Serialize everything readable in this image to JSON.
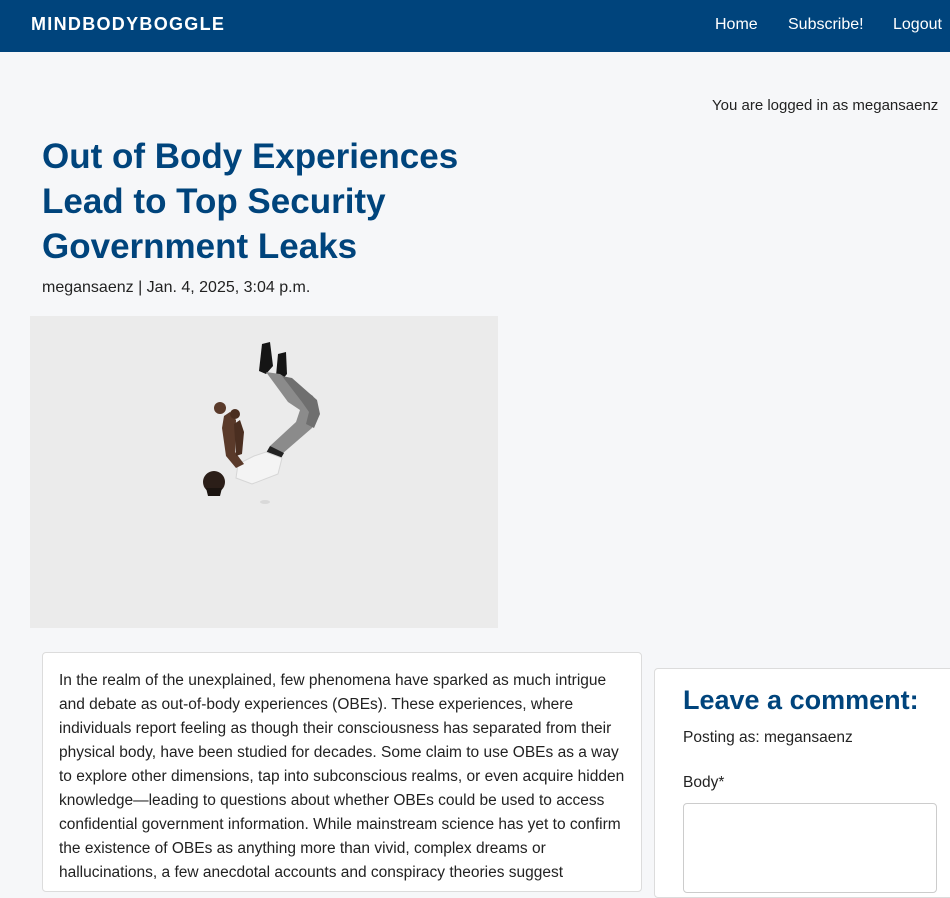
{
  "navbar": {
    "brand": "MINDBODYBOGGLE",
    "links": [
      {
        "label": "Home"
      },
      {
        "label": "Subscribe!"
      },
      {
        "label": "Logout"
      }
    ],
    "background_color": "#00447c"
  },
  "user_status": "You are logged in as megansaenz",
  "post": {
    "title": "Out of Body Experiences Lead to Top Security Government Leaks",
    "byline": "megansaenz | Jan. 4, 2025, 3:04 p.m.",
    "image_description_icon": "person-floating-upside-down-illustration",
    "body": "In the realm of the unexplained, few phenomena have sparked as much intrigue and debate as out-of-body experiences (OBEs). These experiences, where individuals report feeling as though their consciousness has separated from their physical body, have been studied for decades. Some claim to use OBEs as a way to explore other dimensions, tap into subconscious realms, or even acquire hidden knowledge—leading to questions about whether OBEs could be used to access confidential government information. While mainstream science has yet to confirm the existence of OBEs as anything more than vivid, complex dreams or hallucinations, a few anecdotal accounts and conspiracy theories suggest"
  },
  "comment_form": {
    "heading": "Leave a comment:",
    "posting_as": "Posting as: megansaenz",
    "body_label": "Body*",
    "body_value": ""
  },
  "colors": {
    "accent": "#00447c",
    "page_background": "#f6f7f9",
    "image_background": "#ebebeb"
  }
}
